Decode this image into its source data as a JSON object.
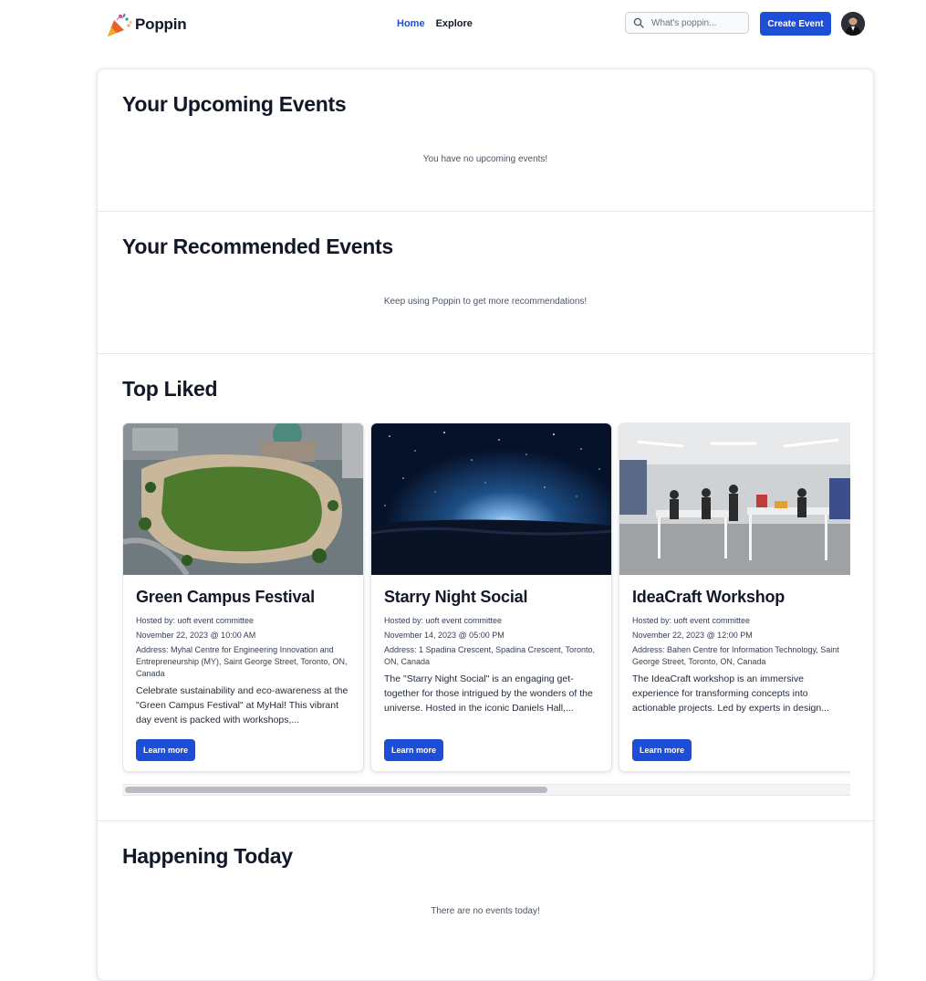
{
  "app": {
    "name": "Poppin"
  },
  "nav": {
    "home": "Home",
    "explore": "Explore"
  },
  "search": {
    "placeholder": "What's poppin..."
  },
  "header": {
    "create_label": "Create Event"
  },
  "sections": {
    "upcoming": {
      "title": "Your Upcoming Events",
      "empty": "You have no upcoming events!"
    },
    "recommended": {
      "title": "Your Recommended Events",
      "empty": "Keep using Poppin to get more recommendations!"
    },
    "top_liked": {
      "title": "Top Liked",
      "learn_label": "Learn more",
      "scroll_position": 0.0,
      "events": [
        {
          "title": "Green Campus Festival",
          "host": "Hosted by: uoft event committee",
          "datetime": "November 22, 2023 @ 10:00 AM",
          "address": "Address: Myhal Centre for Engineering Innovation and Entrepreneurship (MY), Saint George Street, Toronto, ON, Canada",
          "description": "Celebrate sustainability and eco-awareness at the \"Green Campus Festival\" at MyHal! This vibrant day event is packed with workshops,..."
        },
        {
          "title": "Starry Night Social",
          "host": "Hosted by: uoft event committee",
          "datetime": "November 14, 2023 @ 05:00 PM",
          "address": "Address: 1 Spadina Crescent, Spadina Crescent, Toronto, ON, Canada",
          "description": "The \"Starry Night Social\" is an engaging get-together for those intrigued by the wonders of the universe. Hosted in the iconic Daniels Hall,..."
        },
        {
          "title": "IdeaCraft Workshop",
          "host": "Hosted by: uoft event committee",
          "datetime": "November 22, 2023 @ 12:00 PM",
          "address": "Address: Bahen Centre for Information Technology, Saint George Street, Toronto, ON, Canada",
          "description": "The IdeaCraft workshop is an immersive experience for transforming concepts into actionable projects. Led by experts in design..."
        }
      ]
    },
    "today": {
      "title": "Happening Today",
      "empty": "There are no events today!"
    }
  },
  "colors": {
    "accent": "#1d4ed8",
    "text": "#111827",
    "border": "#e5e7eb"
  }
}
